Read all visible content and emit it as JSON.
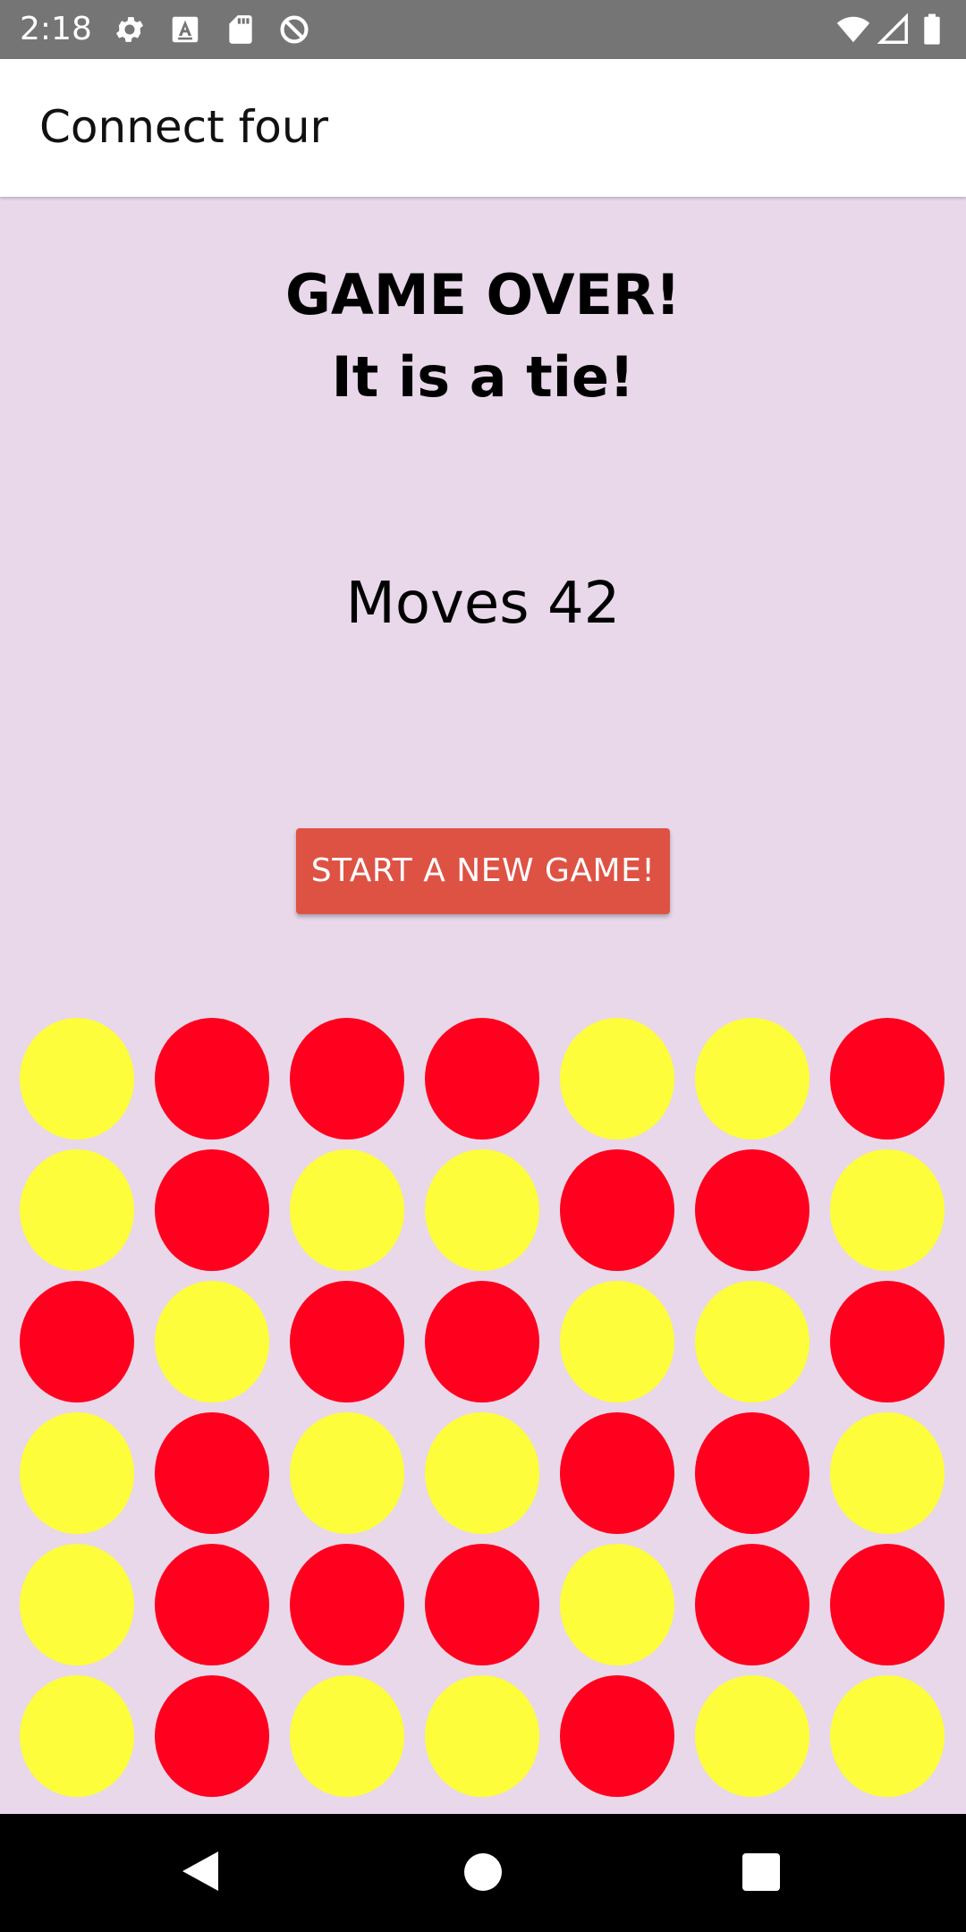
{
  "status_bar": {
    "time": "2:18",
    "left_icons": [
      "settings-icon",
      "a-letter-icon",
      "sd-card-icon",
      "do-not-disturb-icon"
    ],
    "right_icons": [
      "wifi-icon",
      "cell-signal-icon",
      "battery-icon"
    ]
  },
  "app_bar": {
    "title": "Connect four"
  },
  "game": {
    "result_line1": "GAME OVER!",
    "result_line2": "It is a tie!",
    "moves_label": "Moves",
    "moves_count": "42",
    "new_game_button": "START A NEW GAME!"
  },
  "board": {
    "columns": 7,
    "rows": 6,
    "colors": {
      "Y": "#fdfd3b",
      "R": "#ff001e"
    },
    "cells": [
      [
        "Y",
        "R",
        "R",
        "R",
        "Y",
        "Y",
        "R"
      ],
      [
        "Y",
        "R",
        "Y",
        "Y",
        "R",
        "R",
        "Y"
      ],
      [
        "R",
        "Y",
        "R",
        "R",
        "Y",
        "Y",
        "R"
      ],
      [
        "Y",
        "R",
        "Y",
        "Y",
        "R",
        "R",
        "Y"
      ],
      [
        "Y",
        "R",
        "R",
        "R",
        "Y",
        "R",
        "R"
      ],
      [
        "Y",
        "R",
        "Y",
        "Y",
        "R",
        "Y",
        "Y"
      ]
    ]
  },
  "nav_bar": {
    "buttons": [
      "back-icon",
      "home-icon",
      "recents-icon"
    ]
  }
}
